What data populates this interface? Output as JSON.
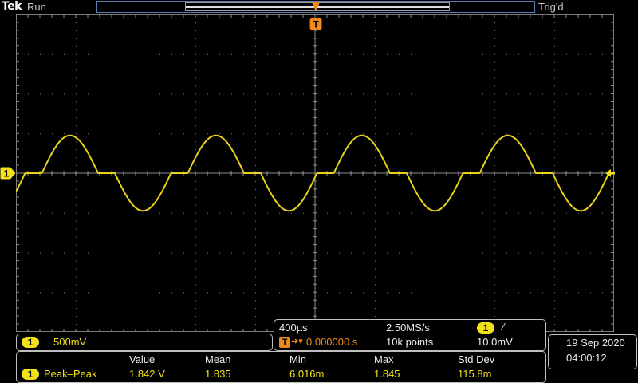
{
  "header": {
    "brand": "Tek",
    "run_state": "Run",
    "trigger_state": "Trig'd"
  },
  "markers": {
    "channel_marker": "1",
    "trigger_marker": "T"
  },
  "channel1": {
    "badge": "1",
    "scale": "500mV"
  },
  "horizontal": {
    "time_per_div": "400µs",
    "sample_rate": "2.50MS/s",
    "trigger_source_badge": "1",
    "trigger_slope": "⁄",
    "trigger_position": "T",
    "trigger_arrow": "➜▾",
    "trigger_delay": "0.000000 s",
    "record_length": "10k points",
    "trigger_level": "10.0mV"
  },
  "datetime": {
    "date": "19 Sep  2020",
    "time": "04:00:12"
  },
  "measurements": {
    "headers": [
      "Value",
      "Mean",
      "Min",
      "Max",
      "Std Dev"
    ],
    "row": {
      "badge": "1",
      "name": "Peak–Peak",
      "value": "1.842 V",
      "mean": "1.835",
      "min": "6.016m",
      "max": "1.845",
      "std_dev": "115.8m"
    }
  },
  "colors": {
    "trace": "#e8d21c",
    "grid": "#7a7a7a",
    "trigger": "#f08a1c",
    "record_bar": "#5a7fb0"
  }
}
